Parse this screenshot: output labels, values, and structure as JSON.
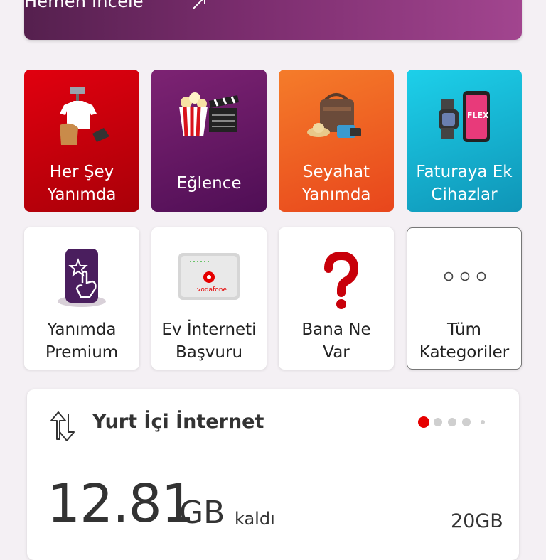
{
  "banner": {
    "text": "Hemen İncele"
  },
  "tiles_row1": [
    {
      "label": "Her Şey\nYanımda",
      "color": "#c8000a",
      "icon": "shopping-items-icon"
    },
    {
      "label": "Eğlence",
      "color": "#6a1a66",
      "icon": "popcorn-clapperboard-icon"
    },
    {
      "label": "Seyahat\nYanımda",
      "color": "#f05a22",
      "icon": "travel-bag-icon"
    },
    {
      "label": "Faturaya Ek\nCihazlar",
      "color": "#15a9c8",
      "icon": "watch-phone-icon"
    }
  ],
  "tiles_row2": [
    {
      "label": "Yanımda\nPremium",
      "icon": "premium-tap-icon"
    },
    {
      "label": "Ev İnterneti\nBaşvuru",
      "icon": "modem-icon"
    },
    {
      "label": "Bana Ne\nVar",
      "icon": "question-mark-icon"
    },
    {
      "label": "Tüm\nKategoriler",
      "icon": "more-dots-icon"
    }
  ],
  "internet_card": {
    "title": "Yurt İçi İnternet",
    "remaining": "12.81",
    "unit": "GB",
    "remaining_label": "kaldı",
    "total": "20GB",
    "usage_remaining_fraction": 0.6405,
    "page_indicator": {
      "count": 5,
      "active": 1
    },
    "icon": "data-transfer-icon",
    "accent": "#e60000"
  }
}
